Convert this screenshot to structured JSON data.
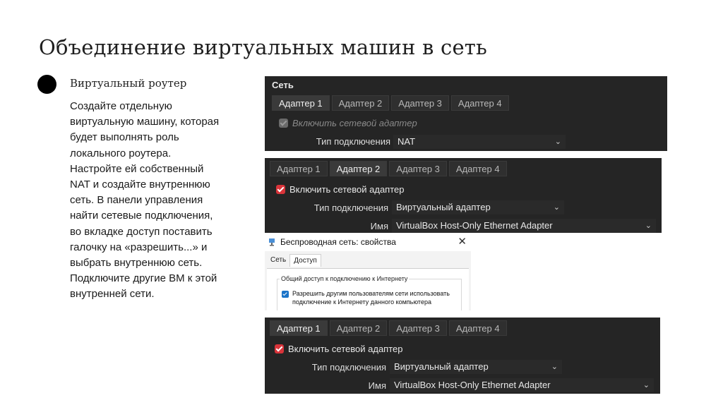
{
  "slide": {
    "title": "Объединение виртуальных машин в сеть",
    "bullet_heading": "Виртуальный роутер",
    "body_lines": [
      "Создайте отдельную",
      "виртуальную машину, которая",
      "будет выполнять роль",
      "локального роутера.",
      "Настройте ей собственный",
      "NAT и создайте внутреннюю",
      "сеть. В панели управления",
      "найти сетевые подключения,",
      "во вкладке доступ поставить",
      "галочку на «разрешить...» и",
      "выбрать внутреннюю сеть.",
      "Подключите другие ВМ к этой",
      "внутренней сети."
    ]
  },
  "panel1": {
    "header": "Сеть",
    "tabs": [
      "Адаптер 1",
      "Адаптер 2",
      "Адаптер 3",
      "Адаптер 4"
    ],
    "active_tab": 0,
    "enable_label": "Включить сетевой адаптер",
    "attached_label": "Тип подключения",
    "attached_value": "NAT"
  },
  "panel2": {
    "tabs": [
      "Адаптер 1",
      "Адаптер 2",
      "Адаптер 3",
      "Адаптер 4"
    ],
    "active_tab": 1,
    "enable_label": "Включить сетевой адаптер",
    "attached_label": "Тип подключения",
    "attached_value": "Виртуальный адаптер",
    "name_label": "Имя",
    "name_value": "VirtualBox Host-Only Ethernet Adapter"
  },
  "dialog": {
    "title": "Беспроводная сеть: свойства",
    "tabs": [
      "Сеть",
      "Доступ"
    ],
    "active_tab": 1,
    "group_label": "Общий доступ к подключению к Интернету",
    "allow_line1": "Разрешить другим пользователям сети использовать",
    "allow_line2": "подключение к Интернету данного компьютера"
  },
  "panel3": {
    "tabs": [
      "Адаптер 1",
      "Адаптер 2",
      "Адаптер 3",
      "Адаптер 4"
    ],
    "active_tab": 0,
    "enable_label": "Включить сетевой адаптер",
    "attached_label": "Тип подключения",
    "attached_value": "Виртуальный адаптер",
    "name_label": "Имя",
    "name_value": "VirtualBox Host-Only Ethernet Adapter"
  },
  "colors": {
    "checkbox_red": "#d9343a",
    "panel_bg": "#252525",
    "windows_checkbox": "#1a73c8"
  }
}
